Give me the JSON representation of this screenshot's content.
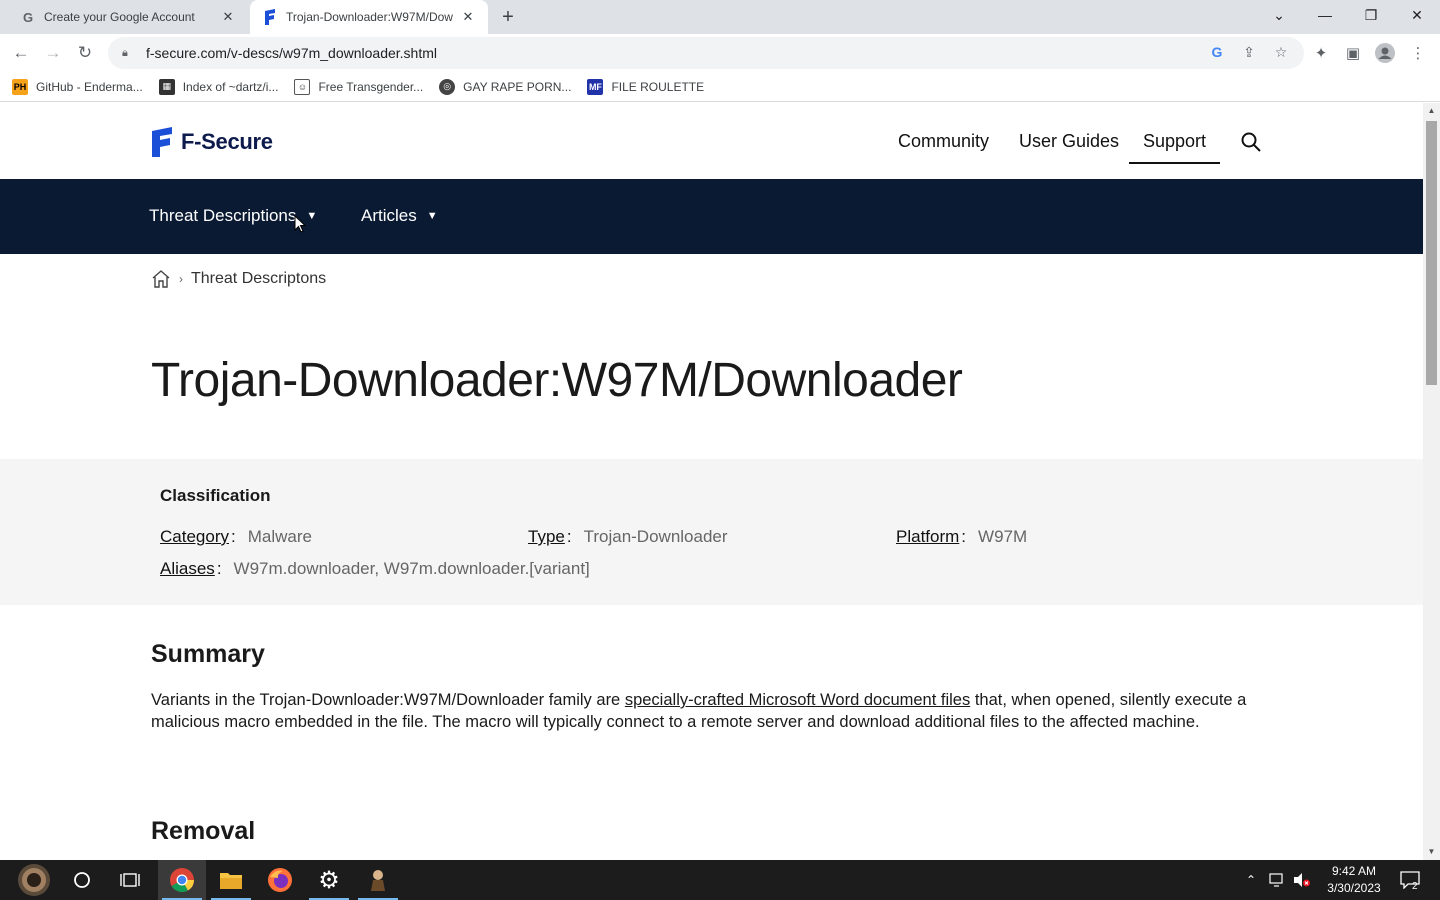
{
  "browser": {
    "tabs": [
      {
        "title": "Create your Google Account",
        "favicon": "google-g-icon"
      },
      {
        "title": "Trojan-Downloader:W97M/Dow",
        "favicon": "f-secure-icon"
      }
    ],
    "url": "f-secure.com/v-descs/w97m_downloader.shtml",
    "bookmarks": [
      {
        "label": "GitHub - Enderma...",
        "icon": "PH"
      },
      {
        "label": "Index of ~dartz/i...",
        "icon": "folder-icon"
      },
      {
        "label": "Free Transgender...",
        "icon": "mask-icon"
      },
      {
        "label": "GAY RAPE PORN...",
        "icon": "globe-icon"
      },
      {
        "label": "FILE ROULETTE",
        "icon": "MF"
      }
    ]
  },
  "site": {
    "logo_text": "F-Secure",
    "top_nav": [
      "Community",
      "User Guides",
      "Support"
    ],
    "sub_nav": [
      "Threat Descriptions",
      "Articles"
    ],
    "breadcrumb": "Threat Descriptons",
    "title": "Trojan-Downloader:W97M/Downloader",
    "classification": {
      "heading": "Classification",
      "category_label": "Category",
      "category_value": "Malware",
      "type_label": "Type",
      "type_value": "Trojan-Downloader",
      "platform_label": "Platform",
      "platform_value": "W97M",
      "aliases_label": "Aliases",
      "aliases_value": "W97m.downloader, W97m.downloader.[variant]"
    },
    "summary_heading": "Summary",
    "summary_before": "Variants in the Trojan-Downloader:W97M/Downloader family are ",
    "summary_link": "specially-crafted Microsoft Word document files",
    "summary_after": " that, when opened, silently execute a malicious macro embedded in the file. The macro will typically connect to a remote server and download additional files to the affected machine.",
    "removal_heading": "Removal"
  },
  "taskbar": {
    "time": "9:42 AM",
    "date": "3/30/2023",
    "notification_count": "2"
  },
  "colors": {
    "nav_dark": "#0b1a33",
    "brand_blue": "#1c4fd8"
  }
}
